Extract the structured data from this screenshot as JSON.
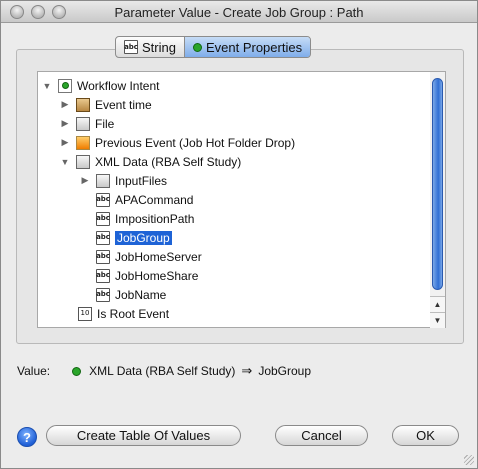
{
  "window": {
    "title": "Parameter Value - Create Job Group : Path"
  },
  "tabs": [
    {
      "label": "String",
      "icon": "abc-icon",
      "active": false
    },
    {
      "label": "Event Properties",
      "icon": "green-check-icon",
      "active": true
    }
  ],
  "tree": {
    "items": [
      {
        "label": "Workflow Intent",
        "icon": "workflow-icon",
        "expanded": true
      },
      {
        "label": "Event time",
        "icon": "calendar-icon",
        "expanded": false
      },
      {
        "label": "File",
        "icon": "file-icon",
        "expanded": false
      },
      {
        "label": "Previous Event (Job Hot Folder Drop)",
        "icon": "event-icon",
        "expanded": false
      },
      {
        "label": "XML Data (RBA Self Study)",
        "icon": "xml-folder-icon",
        "expanded": true
      },
      {
        "label": "InputFiles",
        "icon": "folder-icon",
        "expanded": false
      },
      {
        "label": "APACommand",
        "icon": "abc-icon"
      },
      {
        "label": "ImpositionPath",
        "icon": "abc-icon"
      },
      {
        "label": "JobGroup",
        "icon": "abc-icon",
        "selected": true
      },
      {
        "label": "JobHomeServer",
        "icon": "abc-icon"
      },
      {
        "label": "JobHomeShare",
        "icon": "abc-icon"
      },
      {
        "label": "JobName",
        "icon": "abc-icon"
      },
      {
        "label": "Is Root Event",
        "icon": "boolean-icon"
      }
    ]
  },
  "value": {
    "label": "Value:",
    "source": "XML Data (RBA Self Study)",
    "field": "JobGroup"
  },
  "buttons": {
    "create_table": "Create Table Of Values",
    "cancel": "Cancel",
    "ok": "OK",
    "help": "?"
  },
  "colors": {
    "selection": "#1e63d6",
    "accent_tab": "#7fadea"
  }
}
